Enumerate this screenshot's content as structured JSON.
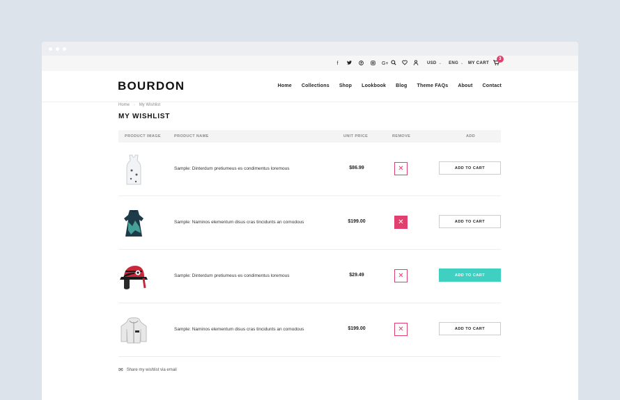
{
  "topbar": {
    "social": [
      "f",
      "t",
      "p",
      "i",
      "G+"
    ],
    "currency": "USD",
    "language": "ENG",
    "cart_label": "MY CART",
    "cart_count": "3"
  },
  "brand": {
    "logo": "BOURDON"
  },
  "nav": [
    "Home",
    "Collections",
    "Shop",
    "Lookbook",
    "Blog",
    "Theme FAQs",
    "About",
    "Contact"
  ],
  "breadcrumb": {
    "home": "Home",
    "current": "My Wishlist"
  },
  "page_title": "MY WISHLIST",
  "table": {
    "headers": [
      "PRODUCT IMAGE",
      "PRODUCT NAME",
      "UNIT PRICE",
      "REMOVE",
      "ADD"
    ],
    "rows": [
      {
        "name": "Sample: Dinterdum pretiumeus es condimentus loremous",
        "price": "$86.99",
        "button": "ADD TO CART",
        "image": "tank-top"
      },
      {
        "name": "Sample: Naminos elementum disus cras tincidunts an comodous",
        "price": "$199.00",
        "button": "ADD TO CART",
        "image": "dress"
      },
      {
        "name": "Sample: Dinterdum pretiumeus es condimentus loremous",
        "price": "$29.49",
        "button": "ADD TO CART",
        "image": "hat"
      },
      {
        "name": "Sample: Naminos elementum disus cras tincidunts an comodous",
        "price": "$199.00",
        "button": "ADD TO CART",
        "image": "jacket"
      }
    ]
  },
  "share_label": "Share my wishlist via email",
  "colors": {
    "accent": "#e0406d",
    "teal": "#3fd0c2"
  }
}
